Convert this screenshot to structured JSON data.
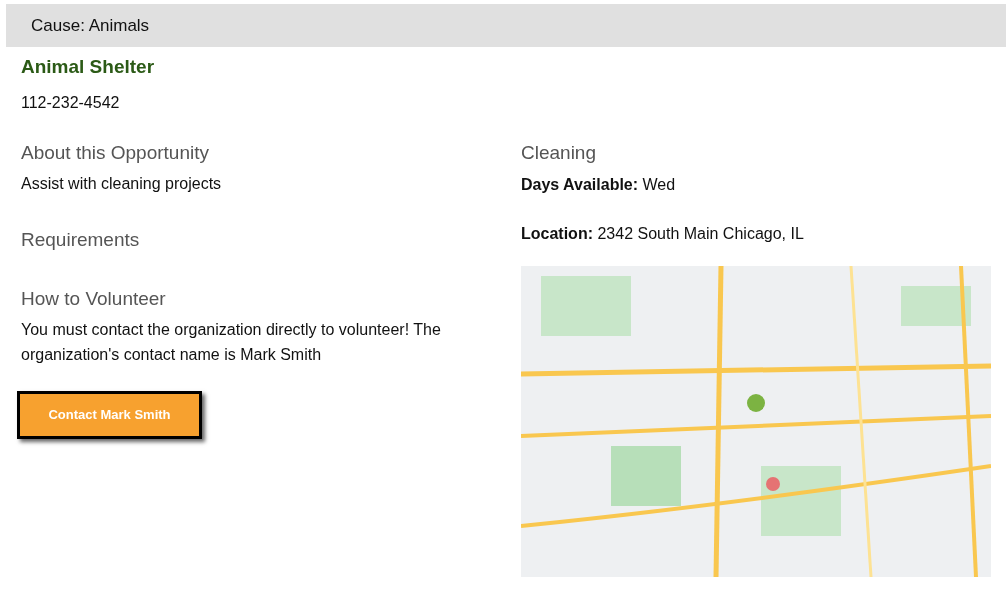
{
  "header": {
    "text": "Cause: Animals"
  },
  "organization": {
    "name": "Animal Shelter",
    "phone": "112-232-4542"
  },
  "left": [
    {
      "heading": "About this Opportunity",
      "body": "Assist with cleaning projects"
    },
    {
      "heading": "Requirements"
    },
    {
      "heading": "How to Volunteer",
      "body": "You must contact the organization directly to volunteer! The organization's contact name is Mark Smith"
    }
  ],
  "contact_button": {
    "label": "Contact Mark Smith"
  },
  "right": {
    "heading": "Cleaning",
    "days": "**Days Available:** Wed",
    "location": "**Location:** 2342 South Main Chicago, IL"
  }
}
